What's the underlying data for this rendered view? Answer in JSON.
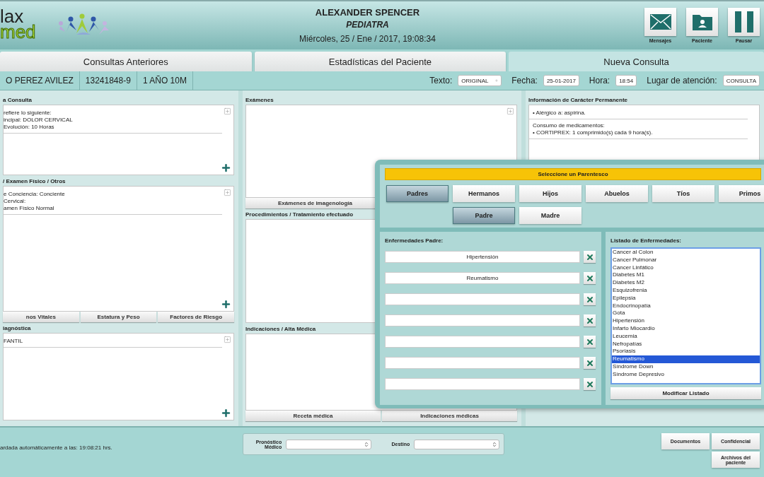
{
  "header": {
    "logo": {
      "line_1": "lax",
      "line_2": "med"
    },
    "doctor_name": "ALEXANDER SPENCER",
    "specialty": "PEDIATRA",
    "datetime": "Miércoles, 25 / Ene / 2017, 19:08:34",
    "actions": [
      {
        "kind": "mail",
        "label": "Mensajes"
      },
      {
        "kind": "folder",
        "label": "Paciente"
      },
      {
        "kind": "pause",
        "label": "Pausar"
      }
    ]
  },
  "tabs": [
    {
      "label": "Consultas Anteriores",
      "selected": false
    },
    {
      "label": "Estadísticas del Paciente",
      "selected": false
    },
    {
      "label": "Nueva Consulta",
      "selected": true
    }
  ],
  "patient": {
    "cells": [
      "O PEREZ AVILEZ",
      "13241848-9",
      "1 AÑO 10M"
    ],
    "fields": [
      {
        "kind": "select",
        "label": "Texto:",
        "value": "ORIGINAL"
      },
      {
        "kind": "input",
        "label": "Fecha:",
        "value": "25-01-2017"
      },
      {
        "kind": "input",
        "label": "Hora:",
        "value": "18:54"
      },
      {
        "kind": "input",
        "label": "Lugar de atención:",
        "value": "CONSULTA"
      }
    ]
  },
  "columns": [
    {
      "sections": [
        {
          "kind": "notes",
          "title": "a Consulta",
          "groups": [
            [
              "refiere lo siguiente:",
              "incipal: DOLOR CERVICAL",
              "Evolución: 10 Horas"
            ]
          ]
        },
        {
          "kind": "notes",
          "title": "/ Examen Físico / Otros",
          "groups": [
            [
              "e Conciencia: Conciente",
              "Cervical:",
              "amen Físico Normal"
            ]
          ],
          "buttons": [
            "nos Vitales",
            "Estatura y Peso",
            "Factores de Riesgo"
          ]
        },
        {
          "kind": "notes",
          "title": "iagnóstica",
          "groups": [
            [
              "FANTIL"
            ]
          ]
        }
      ]
    },
    {
      "sections": [
        {
          "kind": "exam",
          "title": "Exámenes",
          "buttons": [
            "Exámenes de imagenología"
          ]
        },
        {
          "kind": "plain",
          "title": "Procedimientos / Tratamiento efectuado"
        },
        {
          "kind": "plain",
          "title": "Indicaciones / Alta Médica",
          "buttons": [
            "Receta médica",
            "Indicaciones médicas"
          ]
        }
      ]
    },
    {
      "sections": [
        {
          "kind": "info",
          "title": "Información de Carácter Permanente",
          "groups": [
            [
              "• Alérgico a: aspirina."
            ],
            [
              "Consumo de medicamentos:",
              "• CORTIPREX: 1 comprimido(s) cada 9 hora(s)."
            ]
          ]
        }
      ]
    }
  ],
  "footer": {
    "status": "ardada automáticamente a las: 19:08:21 hrs.",
    "selects": [
      {
        "label": "Pronóstico Médico"
      },
      {
        "label": "Destino"
      }
    ],
    "buttons": [
      "Documentos",
      "Confidencial",
      "Archivos del paciente"
    ]
  },
  "modal": {
    "title": "Seleccione un Parentesco",
    "groups": [
      {
        "label": "Padres",
        "selected": true
      },
      {
        "label": "Hermanos",
        "selected": false
      },
      {
        "label": "Hijos",
        "selected": false
      },
      {
        "label": "Abuelos",
        "selected": false
      },
      {
        "label": "Tíos",
        "selected": false
      },
      {
        "label": "Primos",
        "selected": false
      }
    ],
    "members": [
      {
        "label": "Padre",
        "selected": true
      },
      {
        "label": "Madre",
        "selected": false
      }
    ],
    "diseases_title": "Enfermedades Padre:",
    "entries": [
      {
        "kind": "filled",
        "value": "Hipertensión"
      },
      {
        "kind": "filled",
        "value": "Reumatismo"
      },
      {
        "kind": "blank"
      },
      {
        "kind": "blank"
      },
      {
        "kind": "blank"
      },
      {
        "kind": "blank"
      },
      {
        "kind": "blank"
      }
    ],
    "list_title": "Listado de Enfermedades:",
    "list": [
      {
        "label": "Cancer al Colon",
        "selected": false
      },
      {
        "label": "Cancer Pulmonar",
        "selected": false
      },
      {
        "label": "Cancer Linfático",
        "selected": false
      },
      {
        "label": "Diabetes M1",
        "selected": false
      },
      {
        "label": "Diabetes M2",
        "selected": false
      },
      {
        "label": "Esquizofrenia",
        "selected": false
      },
      {
        "label": "Epilepsia",
        "selected": false
      },
      {
        "label": "Endocrinopatía",
        "selected": false
      },
      {
        "label": "Gota",
        "selected": false
      },
      {
        "label": "Hipertensión",
        "selected": false
      },
      {
        "label": "Infarto Miocardio",
        "selected": false
      },
      {
        "label": "Leucemia",
        "selected": false
      },
      {
        "label": "Nefropatías",
        "selected": false
      },
      {
        "label": "Psoriasis",
        "selected": false
      },
      {
        "label": "Reumatismo",
        "selected": true
      },
      {
        "label": "Síndrome Down",
        "selected": false
      },
      {
        "label": "Síndrome Depresivo",
        "selected": false
      }
    ],
    "list_button": "Modificar Listado"
  }
}
